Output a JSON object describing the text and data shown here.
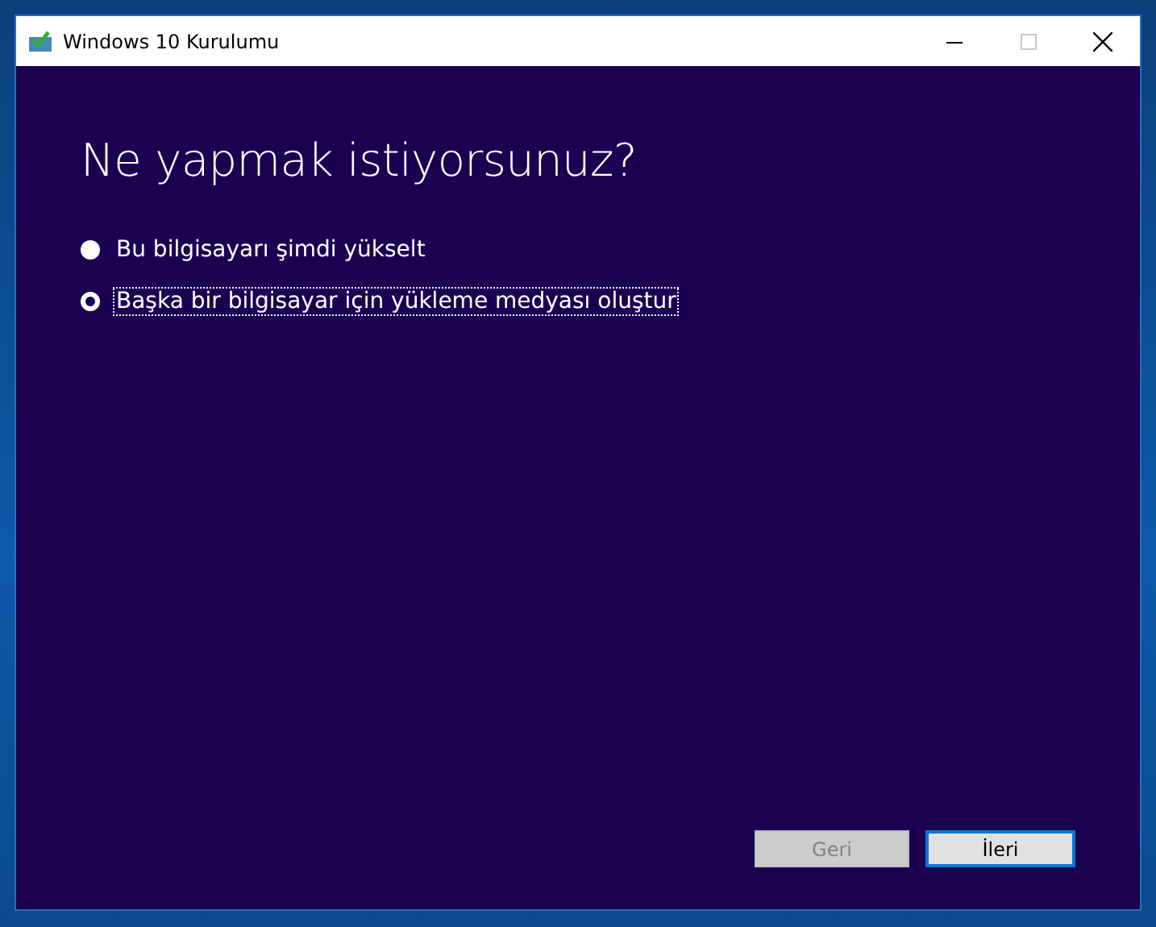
{
  "window": {
    "title": "Windows 10 Kurulumu"
  },
  "heading": "Ne yapmak istiyorsunuz?",
  "options": [
    {
      "label": "Bu bilgisayarı şimdi yükselt",
      "selected": false
    },
    {
      "label": "Başka bir bilgisayar için yükleme medyası oluştur",
      "selected": true
    }
  ],
  "buttons": [
    {
      "label": "Geri",
      "disabled": true,
      "default": false
    },
    {
      "label": "İleri",
      "disabled": false,
      "default": true
    }
  ]
}
